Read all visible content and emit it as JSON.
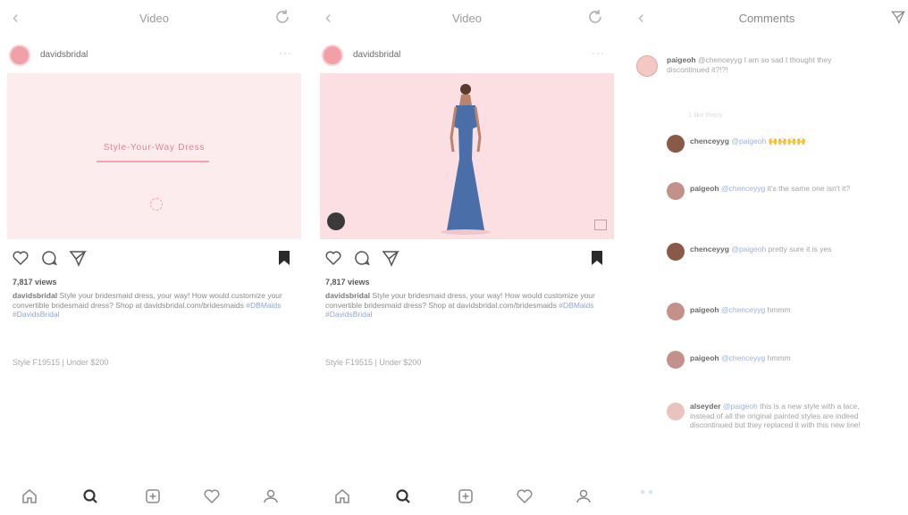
{
  "panels": [
    {
      "header": {
        "title": "Video"
      },
      "post": {
        "username": "davidsbridal",
        "media_title": "Style-Your-Way Dress",
        "views": "7,817 views",
        "caption_user": "davidsbridal",
        "caption_body": " Style your bridesmaid dress, your way! How would customize your convertible bridesmaid dress? Shop at davidsbridal.com/bridesmaids ",
        "caption_tags": "#DBMaids #DavidsBridal",
        "style_line": "Style F19515 | Under $200"
      }
    },
    {
      "header": {
        "title": "Video"
      },
      "post": {
        "username": "davidsbridal",
        "views": "7,817 views",
        "caption_user": "davidsbridal",
        "caption_body": " Style your bridesmaid dress, your way! How would customize your convertible bridesmaid dress? Shop at davidsbridal.com/bridesmaids ",
        "caption_tags": "#DBMaids #DavidsBridal",
        "style_line": "Style F19515 | Under $200"
      }
    }
  ],
  "comments_panel": {
    "title": "Comments",
    "comments": [
      {
        "user": "paigeoh",
        "text": " @chenceyyg I am so sad I thought they discontinued it?!?!",
        "meta": "",
        "reply_meta": "1 like  Reply"
      },
      {
        "user": "chenceyyg",
        "mention": "@paigeoh",
        "text": " 🙌🙌🙌🙌"
      },
      {
        "user": "paigeoh",
        "mention": "@chenceyyg",
        "text": " it's the same one isn't it?"
      },
      {
        "user": "chenceyyg",
        "mention": "@paigeoh",
        "text": " pretty sure it is yes"
      },
      {
        "user": "paigeoh",
        "mention": "@chenceyyg",
        "text": " hmmm"
      },
      {
        "user": "paigeoh",
        "mention": "@chenceyyg",
        "text": " hmmm"
      },
      {
        "user": "alseyder",
        "mention": "@paigeoh",
        "text": " this is a new style with a lace, instead of all the original painted styles are indeed discontinued but they replaced it with this new line!"
      }
    ]
  },
  "colors": {
    "accent_pink": "#e7828f",
    "tag_blue": "#8fa6d8",
    "dress_blue": "#4a6fa8"
  }
}
